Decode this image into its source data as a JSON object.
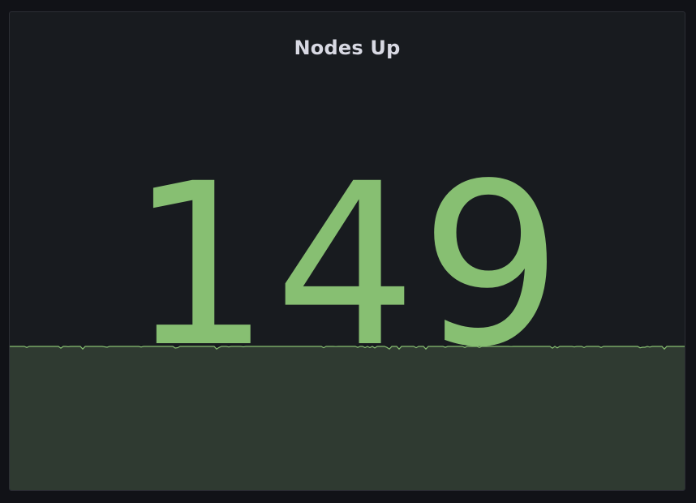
{
  "panel": {
    "title": "Nodes Up",
    "value": "149"
  },
  "colors": {
    "background": "#111217",
    "panel_background": "#181b1f",
    "value_color": "#87bf72",
    "sparkline_fill": "#2f3a31",
    "sparkline_line": "#87bf72"
  }
}
